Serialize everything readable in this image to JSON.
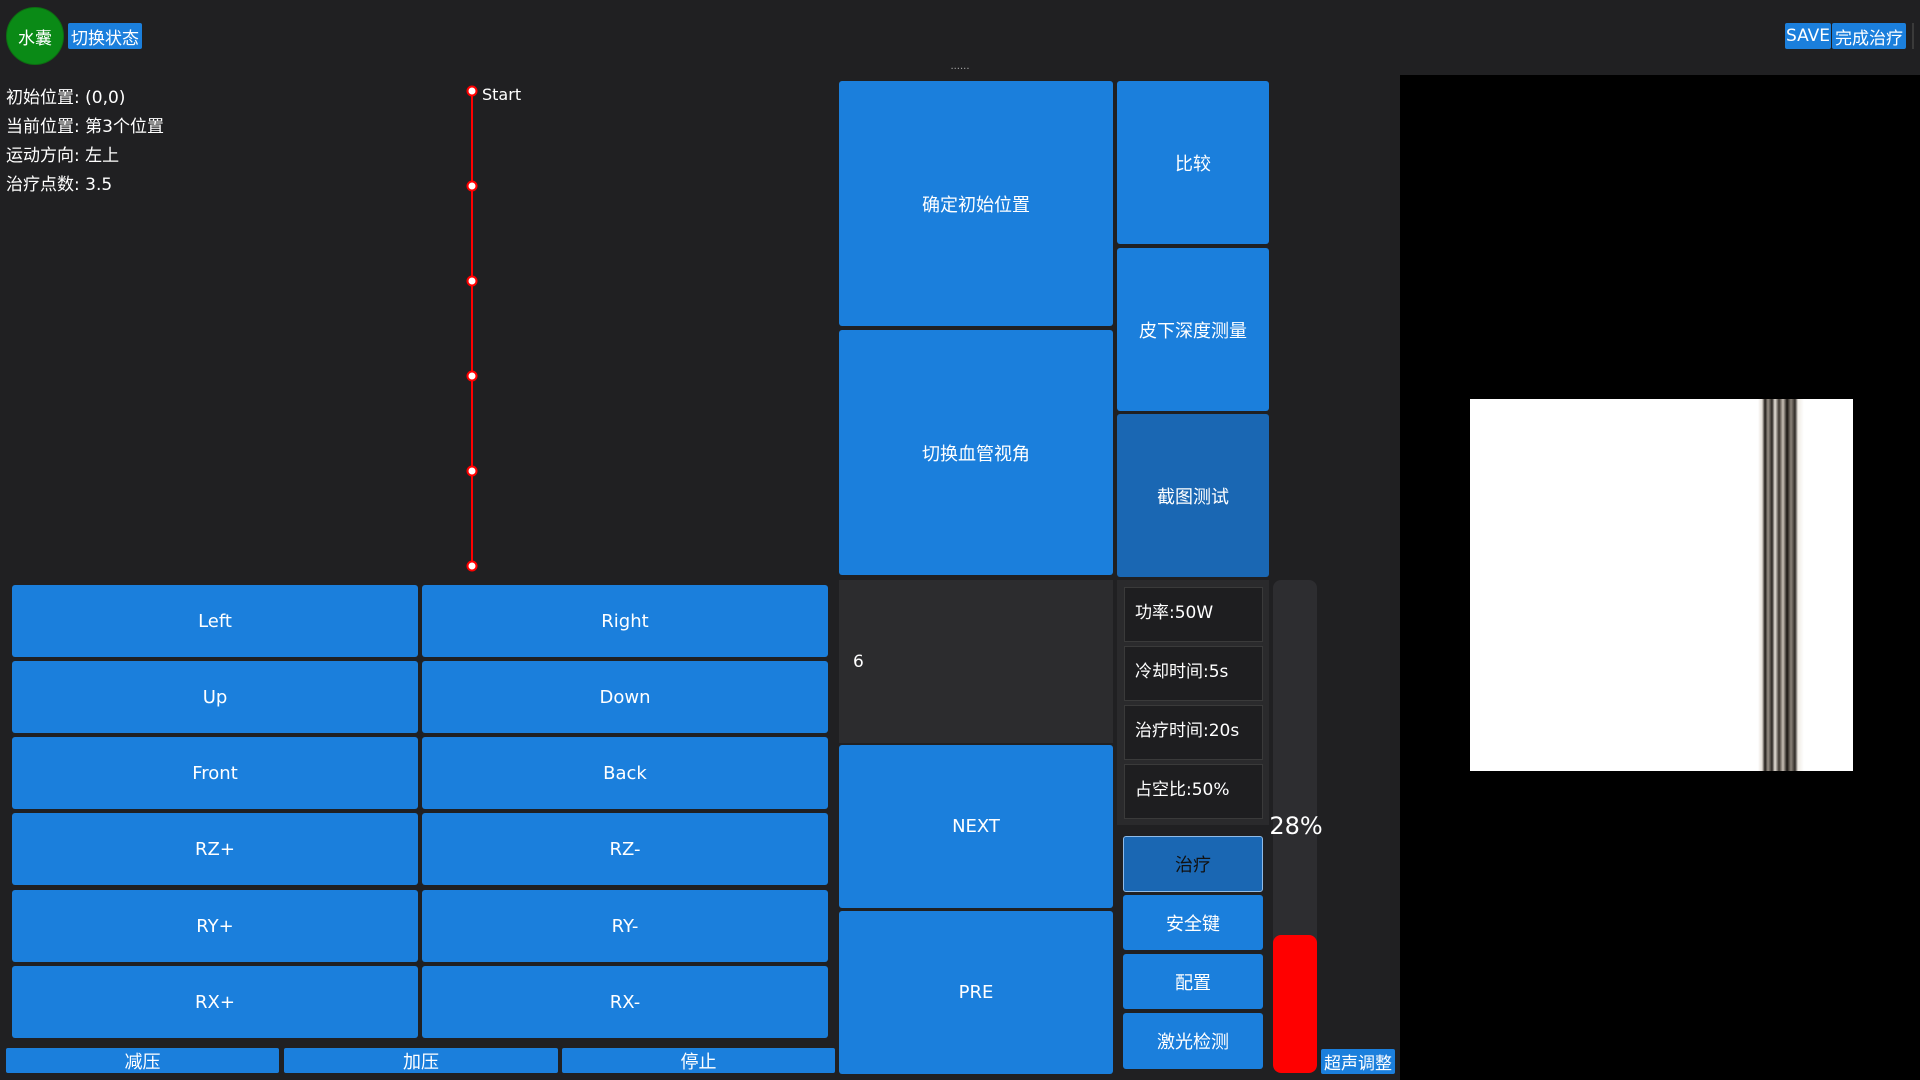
{
  "header": {
    "status_circle_label": "水囊",
    "switch_state_label": "切换状态",
    "save_label": "SAVE",
    "finish_label": "完成治疗",
    "drag_handle": "......"
  },
  "info": {
    "initial_pos_label": "初始位置:",
    "initial_pos_value": "(0,0)",
    "current_pos_label": "当前位置:",
    "current_pos_value": "第3个位置",
    "direction_label": "运动方向:",
    "direction_value": "左上",
    "points_label": "治疗点数:",
    "points_value": "3.5"
  },
  "path": {
    "start_label": "Start",
    "point_count": 6,
    "line_color": "#ff0000"
  },
  "motion": [
    {
      "left": "Left",
      "right": "Right"
    },
    {
      "left": "Up",
      "right": "Down"
    },
    {
      "left": "Front",
      "right": "Back"
    },
    {
      "left": "RZ+",
      "right": "RZ-"
    },
    {
      "left": "RY+",
      "right": "RY-"
    },
    {
      "left": "RX+",
      "right": "RX-"
    }
  ],
  "bottom": {
    "decompress": "减压",
    "compress": "加压",
    "stop": "停止"
  },
  "center": {
    "confirm_initial": "确定初始位置",
    "switch_vessel_view": "切换血管视角",
    "counter_value": "6",
    "next": "NEXT",
    "pre": "PRE"
  },
  "right_col": {
    "compare": "比较",
    "subcutaneous_depth": "皮下深度测量",
    "screenshot_test": "截图测试"
  },
  "params": {
    "power": "功率:50W",
    "cooling_time": "冷却时间:5s",
    "treatment_time": "治疗时间:20s",
    "duty_cycle": "占空比:50%"
  },
  "actions": {
    "treat": "治疗",
    "safety_key": "安全键",
    "config": "配置",
    "laser_detect": "激光检测"
  },
  "gauge": {
    "percent_label": "28%",
    "fill_fraction": 0.28,
    "fill_color": "#ff0000"
  },
  "ultrasound_adjust": "超声调整",
  "colors": {
    "accent": "#1b7fdc",
    "background": "#202022",
    "status_green": "#0a8a16"
  }
}
